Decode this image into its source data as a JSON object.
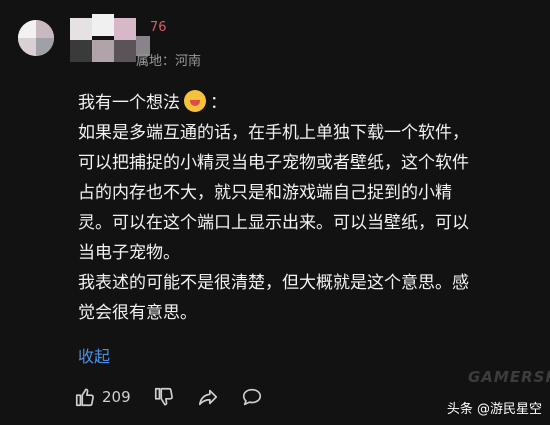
{
  "user": {
    "name_suffix": "76",
    "location": "属地：河南"
  },
  "comment": {
    "lines": [
      "我有一个想法",
      "如果是多端互通的话，在手机上单独下载一个软件，",
      "可以把捕捉的小精灵当电子宠物或者壁纸，这个软件",
      "占的内存也不大，就只是和游戏端自己捉到的小精",
      "灵。可以在这个端口上显示出来。可以当壁纸，可以",
      "当电子宠物。",
      "我表述的可能不是很清楚，但大概就是这个意思。感",
      "觉会很有意思。"
    ],
    "after_emoji": "："
  },
  "collapse_label": "收起",
  "actions": {
    "like_count": "209"
  },
  "watermark": {
    "text": "头条 @游民星空",
    "logo": "GAMERSKY"
  },
  "colors": {
    "background": "#121212",
    "username": "#d85a6a",
    "link": "#4d8fe0"
  }
}
